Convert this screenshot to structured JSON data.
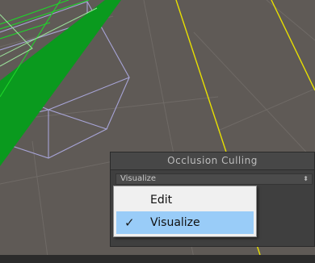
{
  "panel": {
    "title": "Occlusion Culling",
    "mode_select": {
      "value": "Visualize",
      "arrow_icon": "updown-arrow-icon"
    }
  },
  "dropdown": {
    "options": [
      {
        "label": "Edit",
        "selected": false
      },
      {
        "label": "Visualize",
        "selected": true
      }
    ],
    "check_icon": "checkmark-icon"
  },
  "colors": {
    "scene_background": "#5f5a56",
    "panel_background": "#3f3f3f",
    "selection_highlight": "#99ccf8",
    "frustum_green": "#0a9a1e",
    "gizmo_yellow": "#e8e000"
  }
}
